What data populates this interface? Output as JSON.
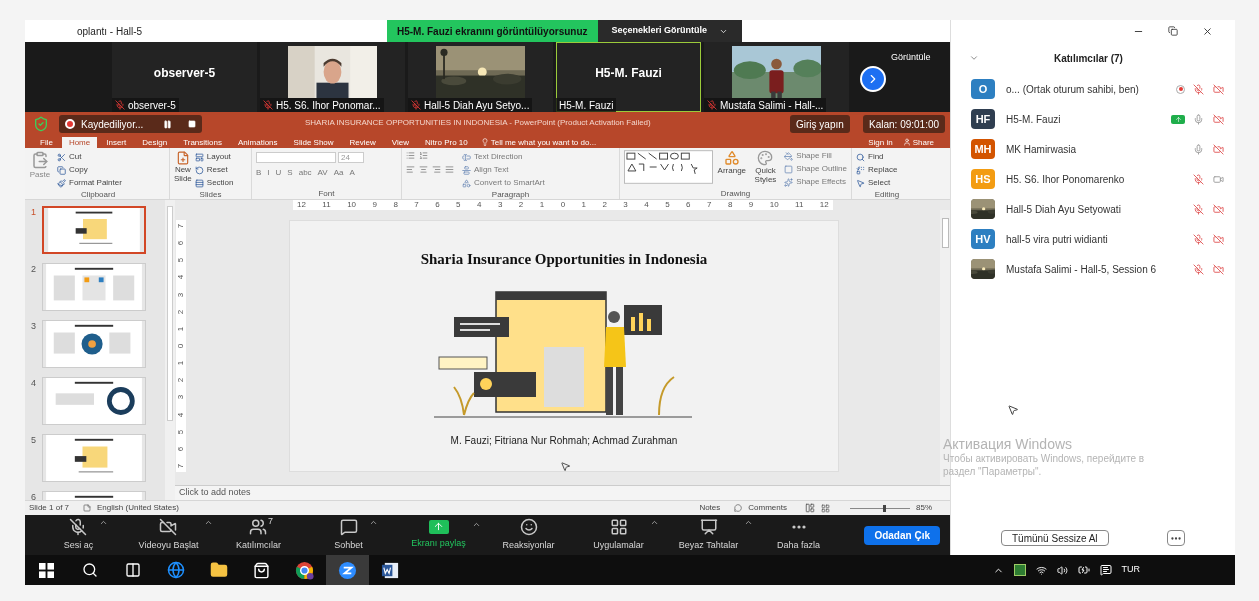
{
  "meeting_title": "oplantı - Hall-5",
  "share_banner": {
    "text": "H5-M. Fauzi ekranını görüntülüyorsunuz",
    "options": "Seçenekleri Görüntüle"
  },
  "video_strip": {
    "view_label": "Görüntüle",
    "tiles": [
      {
        "kind": "name",
        "title": "observer-5",
        "label": "observer-5",
        "muted": true,
        "selected": false
      },
      {
        "kind": "picture",
        "label": "H5. S6. Ihor Ponomar...",
        "muted": true,
        "selected": false
      },
      {
        "kind": "picture",
        "label": "Hall-5 Diah Ayu Setyo...",
        "muted": true,
        "selected": false
      },
      {
        "kind": "name",
        "title": "H5-M. Fauzi",
        "label": "H5-M. Fauzi",
        "muted": false,
        "selected": true
      },
      {
        "kind": "picture",
        "label": "Mustafa Salimi - Hall-...",
        "muted": true,
        "selected": false
      }
    ]
  },
  "powerpoint": {
    "recording": "Kaydediliyor...",
    "title": "SHARIA INSURANCE OPPORTUNITIES IN INDONESIA - PowerPoint (Product Activation Failed)",
    "sign_in_button": "Giriş yapın",
    "remaining": "Kalan: 09:01:00",
    "tabs": [
      {
        "label": "File",
        "selected": false
      },
      {
        "label": "Home",
        "selected": true
      },
      {
        "label": "Insert",
        "selected": false
      },
      {
        "label": "Design",
        "selected": false
      },
      {
        "label": "Transitions",
        "selected": false
      },
      {
        "label": "Animations",
        "selected": false
      },
      {
        "label": "Slide Show",
        "selected": false
      },
      {
        "label": "Review",
        "selected": false
      },
      {
        "label": "View",
        "selected": false
      },
      {
        "label": "Nitro Pro 10",
        "selected": false
      }
    ],
    "tell_me": "Tell me what you want to do...",
    "sign_in": "Sign in",
    "share": "Share",
    "ribbon": {
      "clipboard": {
        "label": "Clipboard",
        "paste": "Paste",
        "items": [
          "Cut",
          "Copy",
          "Format Painter"
        ]
      },
      "slides": {
        "label": "Slides",
        "new_slide": [
          "New",
          "Slide"
        ],
        "items": [
          "Layout",
          "Reset",
          "Section"
        ]
      },
      "font": {
        "label": "Font",
        "size": "24",
        "buttons": [
          "B",
          "I",
          "U",
          "S",
          "abc",
          "AV",
          "Aa",
          "A"
        ]
      },
      "paragraph": {
        "label": "Paragraph",
        "items": [
          "Text Direction",
          "Align Text",
          "Convert to SmartArt"
        ]
      },
      "drawing": {
        "label": "Drawing",
        "large": [
          "Arrange",
          "Quick Styles"
        ],
        "items": [
          "Shape Fill",
          "Shape Outline",
          "Shape Effects"
        ]
      },
      "editing": {
        "label": "Editing",
        "items": [
          "Find",
          "Replace",
          "Select"
        ]
      }
    },
    "ruler": {
      "horizontal": [
        "12",
        "11",
        "10",
        "9",
        "8",
        "7",
        "6",
        "5",
        "4",
        "3",
        "2",
        "1",
        "0",
        "1",
        "2",
        "3",
        "4",
        "5",
        "6",
        "7",
        "8",
        "9",
        "10",
        "11",
        "12"
      ],
      "vertical": [
        "7",
        "6",
        "5",
        "4",
        "3",
        "2",
        "1",
        "0",
        "1",
        "2",
        "3",
        "4",
        "5",
        "6",
        "7"
      ]
    },
    "thumbnails": [
      {
        "number": "1",
        "selected": true
      },
      {
        "number": "2",
        "selected": false
      },
      {
        "number": "3",
        "selected": false
      },
      {
        "number": "4",
        "selected": false
      },
      {
        "number": "5",
        "selected": false
      },
      {
        "number": "6",
        "selected": false
      }
    ],
    "slide": {
      "title": "Sharia Insurance Opportunities in Indonesia",
      "authors": "M. Fauzi; Fitriana Nur Rohmah; Achmad Zurahman"
    },
    "notes_placeholder": "Click to add notes",
    "status_bar": {
      "slide": "Slide 1 of 7",
      "language": "English (United States)",
      "notes": "Notes",
      "comments": "Comments",
      "zoom": "85%",
      "level": 0.55
    }
  },
  "zoom_toolbar": {
    "items": [
      {
        "kind": "mic",
        "label": "Sesi aç",
        "caret": true
      },
      {
        "kind": "video",
        "label": "Videoyu Başlat",
        "caret": true
      },
      {
        "kind": "participants",
        "label": "Katılımcılar",
        "count": "7",
        "caret": false
      },
      {
        "kind": "chat",
        "label": "Sohbet",
        "caret": true
      },
      {
        "kind": "share",
        "label": "Ekranı paylaş",
        "caret": true
      },
      {
        "kind": "reactions",
        "label": "Reaksiyonlar",
        "caret": false
      },
      {
        "kind": "apps",
        "label": "Uygulamalar",
        "caret": true
      },
      {
        "kind": "whiteboard",
        "label": "Beyaz Tahtalar",
        "caret": true
      },
      {
        "kind": "more",
        "label": "Daha fazla",
        "caret": false
      }
    ],
    "leave": "Odadan Çık"
  },
  "participants_panel": {
    "title": "Katılımcılar (7)",
    "mute_all": "Tümünü Sessize Al",
    "participants": [
      {
        "kind": "initials",
        "initials": "O",
        "color": "#2d7fc1",
        "name": "o... (Ortak oturum sahibi, ben)",
        "recording": true,
        "sharing": false,
        "muted": true,
        "video_off": true
      },
      {
        "kind": "initials",
        "initials": "HF",
        "color": "#2f3e50",
        "name": "H5-M. Fauzi",
        "recording": false,
        "sharing": true,
        "muted": false,
        "video_off": true
      },
      {
        "kind": "initials",
        "initials": "MH",
        "color": "#d35400",
        "name": "MK Hamirwasia",
        "recording": false,
        "sharing": false,
        "muted": false,
        "video_off": true
      },
      {
        "kind": "initials",
        "initials": "HS",
        "color": "#f39c12",
        "name": "H5. S6. Ihor Ponomarenko",
        "recording": false,
        "sharing": false,
        "muted": true,
        "video_off": false
      },
      {
        "kind": "picture",
        "name": "Hall-5 Diah Ayu Setyowati",
        "recording": false,
        "sharing": false,
        "muted": true,
        "video_off": true
      },
      {
        "kind": "initials",
        "initials": "HV",
        "color": "#2d7fc1",
        "name": "hall-5 vira putri widianti",
        "recording": false,
        "sharing": false,
        "muted": true,
        "video_off": true
      },
      {
        "kind": "picture",
        "name": "Mustafa Salimi - Hall-5, Session 6",
        "recording": false,
        "sharing": false,
        "muted": true,
        "video_off": true
      }
    ]
  },
  "activation_notice": {
    "title": "Активация Windows",
    "lines": [
      "Чтобы активировать Windows, перейдите в",
      "раздел \"Параметры\"."
    ]
  },
  "taskbar": {
    "language": "TUR",
    "apps": [
      {
        "kind": "start",
        "selected": false
      },
      {
        "kind": "search",
        "selected": false
      },
      {
        "kind": "task-view",
        "selected": false
      },
      {
        "kind": "edge",
        "selected": false
      },
      {
        "kind": "folder",
        "selected": false
      },
      {
        "kind": "store",
        "selected": false
      },
      {
        "kind": "chrome",
        "selected": false
      },
      {
        "kind": "zoom",
        "selected": true
      },
      {
        "kind": "word",
        "selected": false
      }
    ]
  }
}
